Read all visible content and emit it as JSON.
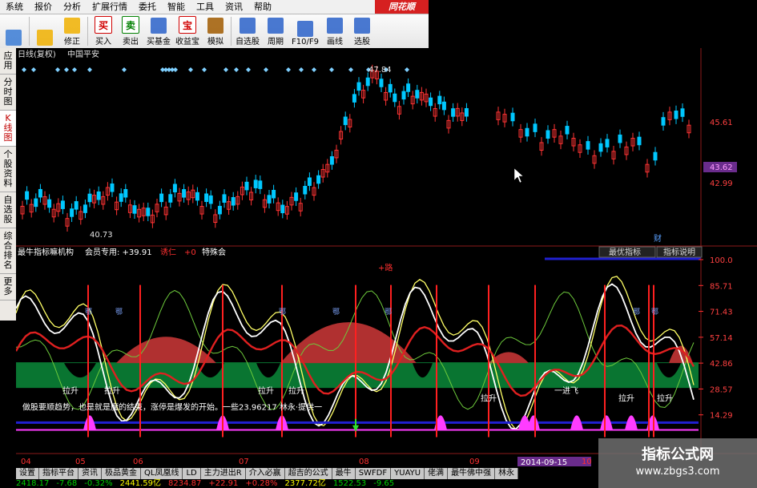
{
  "menu": {
    "items": [
      "系统",
      "报价",
      "分析",
      "扩展行情",
      "委托",
      "智能",
      "工具",
      "资讯",
      "帮助"
    ],
    "brand": "同花顺"
  },
  "toolbar": {
    "buttons": [
      {
        "label": "",
        "icon": "color-blocks-icon",
        "color": "#3a7bd5"
      },
      {
        "label": "",
        "icon": "back-arrow-icon",
        "color": "#f0b000"
      },
      {
        "label": "修正",
        "icon": "up-down-arrow-icon",
        "color": "#f0b000"
      },
      {
        "label": "买入",
        "icon": "buy-icon",
        "glyph": "买",
        "color": "#d00000"
      },
      {
        "label": "卖出",
        "icon": "sell-icon",
        "glyph": "卖",
        "color": "#008000"
      },
      {
        "label": "买基金",
        "icon": "fund-icon",
        "color": "#2a62c9"
      },
      {
        "label": "收益宝",
        "icon": "treasure-icon",
        "glyph": "宝",
        "color": "#d00000"
      },
      {
        "label": "模拟",
        "icon": "gavel-icon",
        "color": "#a05a00"
      },
      {
        "label": "自选股",
        "icon": "star-list-icon",
        "color": "#2a62c9"
      },
      {
        "label": "周期",
        "icon": "clock-icon",
        "color": "#2a62c9"
      },
      {
        "label": "F10/F9",
        "icon": "f10-icon",
        "color": "#2a62c9"
      },
      {
        "label": "画线",
        "icon": "pencil-icon",
        "color": "#2a62c9"
      },
      {
        "label": "选股",
        "icon": "select-stock-icon",
        "color": "#2a62c9"
      }
    ]
  },
  "sidetabs": [
    {
      "label": "应用",
      "active": false
    },
    {
      "label": "分时图",
      "active": false
    },
    {
      "label": "K线图",
      "active": true
    },
    {
      "label": "个股资料",
      "active": false
    },
    {
      "label": "自选股",
      "active": false
    },
    {
      "label": "综合排名",
      "active": false
    },
    {
      "label": "更多",
      "active": false
    }
  ],
  "kline_header": {
    "period": "日线(复权)",
    "name": "中国平安"
  },
  "price_axis": {
    "labels": [
      "45.61",
      "43.62",
      "42.99"
    ],
    "current": "43.62"
  },
  "price_marks": {
    "high": "47.84",
    "low": "40.73",
    "marker": "财"
  },
  "indicator_header": {
    "name": "最牛指标嘛机构",
    "member": "会员专用: +39.91",
    "extra1": "诱仁",
    "extra2": "+0",
    "special": "特殊会",
    "btn_best": "最优指标",
    "btn_explain": "指标说明"
  },
  "indicator_axis": [
    "100.0",
    "85.71",
    "71.43",
    "57.14",
    "42.86",
    "28.57",
    "14.29"
  ],
  "indicator_labels": {
    "top_tag": "+路",
    "mid_tags": [
      "鄂",
      "鄂",
      "鄂",
      "鄂",
      "鄂",
      "鄂",
      "鄂"
    ],
    "rise": [
      "拉升",
      "拉升",
      "拉升",
      "拉升",
      "拉升",
      "拉升",
      "拉升"
    ],
    "lift": "一进飞",
    "note": "做股要顺趋势，也是就是魔的结束，涨停是爆发的开始。一些23.96217 林永·提供一",
    "date_tip": "2014-09-15"
  },
  "months": [
    "04",
    "05",
    "06",
    "07",
    "08",
    "09",
    "10"
  ],
  "bottom_tabs": [
    "设置",
    "指标平台",
    "资讯",
    "极品黄金",
    "QL凤凰线",
    "LD",
    "主力进出R",
    "介入必赢",
    "超吉的公式",
    "最牛",
    "SWFDF",
    "YUAYU",
    "佬满",
    "最牛佛中强",
    "林永"
  ],
  "quotes": [
    {
      "text": "2418.17",
      "color": "#00d000"
    },
    {
      "text": "-7.68",
      "color": "#00d000"
    },
    {
      "text": "-0.32%",
      "color": "#00d000"
    },
    {
      "text": "2441.59亿",
      "color": "#ffff00"
    },
    {
      "text": "8234.87",
      "color": "#ff3030"
    },
    {
      "text": "+22.91",
      "color": "#ff3030"
    },
    {
      "text": "+0.28%",
      "color": "#ff3030"
    },
    {
      "text": "2377.72亿",
      "color": "#ffff00"
    },
    {
      "text": "1522.53",
      "color": "#00d000"
    },
    {
      "text": "-9.65",
      "color": "#00d000"
    }
  ],
  "watermark": {
    "line1": "指标公式网",
    "line2": "www.zbgs3.com"
  },
  "colors": {
    "up": "#ff3333",
    "down": "#00c8ff",
    "accent": "#ff3030",
    "deep_blue": "#2020d0"
  }
}
